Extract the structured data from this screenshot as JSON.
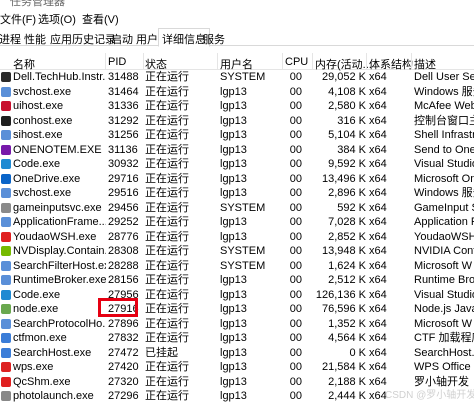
{
  "app": {
    "title": "任务管理器"
  },
  "menu": [
    "文件(F)",
    "选项(O)",
    "查看(V)"
  ],
  "tabs": [
    "进程",
    "性能",
    "应用历史记录",
    "启动",
    "用户",
    "详细信息",
    "服务"
  ],
  "active_tab": "详细信息",
  "columns": [
    "名称",
    "PID",
    "状态",
    "用户名",
    "CPU",
    "内存(活动...",
    "体系结构",
    "描述"
  ],
  "rows": [
    {
      "name": "Dell.TechHub.Instr...",
      "pid": "31488",
      "status": "正在运行",
      "user": "SYSTEM",
      "cpu": "00",
      "mem": "29,052 K",
      "arch": "x64",
      "desc": "Dell User Sess",
      "icon_color": "#2a2a2a"
    },
    {
      "name": "svchost.exe",
      "pid": "31464",
      "status": "正在运行",
      "user": "lgp13",
      "cpu": "00",
      "mem": "4,108 K",
      "arch": "x64",
      "desc": "Windows 服务",
      "icon_color": "#5a8fd8"
    },
    {
      "name": "uihost.exe",
      "pid": "31336",
      "status": "正在运行",
      "user": "lgp13",
      "cpu": "00",
      "mem": "2,580 K",
      "arch": "x64",
      "desc": "McAfee WebA",
      "icon_color": "#c8102e"
    },
    {
      "name": "conhost.exe",
      "pid": "31292",
      "status": "正在运行",
      "user": "lgp13",
      "cpu": "00",
      "mem": "316 K",
      "arch": "x64",
      "desc": "控制台窗口主",
      "icon_color": "#1e1e1e"
    },
    {
      "name": "sihost.exe",
      "pid": "31256",
      "status": "正在运行",
      "user": "lgp13",
      "cpu": "00",
      "mem": "5,104 K",
      "arch": "x64",
      "desc": "Shell Infrastru",
      "icon_color": "#5a8fd8"
    },
    {
      "name": "ONENOTEM.EXE",
      "pid": "31136",
      "status": "正在运行",
      "user": "lgp13",
      "cpu": "00",
      "mem": "384 K",
      "arch": "x64",
      "desc": "Send to One",
      "icon_color": "#7719aa"
    },
    {
      "name": "Code.exe",
      "pid": "30932",
      "status": "正在运行",
      "user": "lgp13",
      "cpu": "00",
      "mem": "9,592 K",
      "arch": "x64",
      "desc": "Visual Studio",
      "icon_color": "#1f8ad2"
    },
    {
      "name": "OneDrive.exe",
      "pid": "29716",
      "status": "正在运行",
      "user": "lgp13",
      "cpu": "00",
      "mem": "13,496 K",
      "arch": "x64",
      "desc": "Microsoft On",
      "icon_color": "#0a64c8"
    },
    {
      "name": "svchost.exe",
      "pid": "29516",
      "status": "正在运行",
      "user": "lgp13",
      "cpu": "00",
      "mem": "2,896 K",
      "arch": "x64",
      "desc": "Windows 服务",
      "icon_color": "#5a8fd8"
    },
    {
      "name": "gameinputsvc.exe",
      "pid": "29456",
      "status": "正在运行",
      "user": "SYSTEM",
      "cpu": "00",
      "mem": "592 K",
      "arch": "x64",
      "desc": "GameInput S",
      "icon_color": "#8a8a8a"
    },
    {
      "name": "ApplicationFrame...",
      "pid": "29252",
      "status": "正在运行",
      "user": "lgp13",
      "cpu": "00",
      "mem": "7,028 K",
      "arch": "x64",
      "desc": "Application F",
      "icon_color": "#5a8fd8"
    },
    {
      "name": "YoudaoWSH.exe",
      "pid": "28776",
      "status": "正在运行",
      "user": "lgp13",
      "cpu": "00",
      "mem": "2,852 K",
      "arch": "x64",
      "desc": "YoudaoWSH",
      "icon_color": "#e02020"
    },
    {
      "name": "NVDisplay.Contain...",
      "pid": "28308",
      "status": "正在运行",
      "user": "SYSTEM",
      "cpu": "00",
      "mem": "13,948 K",
      "arch": "x64",
      "desc": "NVIDIA Conta",
      "icon_color": "#76b900"
    },
    {
      "name": "SearchFilterHost.exe",
      "pid": "28288",
      "status": "正在运行",
      "user": "SYSTEM",
      "cpu": "00",
      "mem": "1,624 K",
      "arch": "x64",
      "desc": "Microsoft W",
      "icon_color": "#5a8fd8"
    },
    {
      "name": "RuntimeBroker.exe",
      "pid": "28156",
      "status": "正在运行",
      "user": "lgp13",
      "cpu": "00",
      "mem": "2,512 K",
      "arch": "x64",
      "desc": "Runtime Brok",
      "icon_color": "#5a8fd8"
    },
    {
      "name": "Code.exe",
      "pid": "27956",
      "status": "正在运行",
      "user": "lgp13",
      "cpu": "00",
      "mem": "126,136 K",
      "arch": "x64",
      "desc": "Visual Studio",
      "icon_color": "#1f8ad2"
    },
    {
      "name": "node.exe",
      "pid": "27916",
      "status": "正在运行",
      "user": "lgp13",
      "cpu": "00",
      "mem": "76,596 K",
      "arch": "x64",
      "desc": "Node.js Java",
      "icon_color": "#6aa84f"
    },
    {
      "name": "SearchProtocolHo...",
      "pid": "27896",
      "status": "正在运行",
      "user": "lgp13",
      "cpu": "00",
      "mem": "1,352 K",
      "arch": "x64",
      "desc": "Microsoft W",
      "icon_color": "#5a8fd8"
    },
    {
      "name": "ctfmon.exe",
      "pid": "27832",
      "status": "正在运行",
      "user": "lgp13",
      "cpu": "00",
      "mem": "4,564 K",
      "arch": "x64",
      "desc": "CTF 加载程序",
      "icon_color": "#3b7dd8"
    },
    {
      "name": "SearchHost.exe",
      "pid": "27472",
      "status": "已挂起",
      "user": "lgp13",
      "cpu": "00",
      "mem": "0 K",
      "arch": "x64",
      "desc": "SearchHost.e",
      "icon_color": "#3b7dd8"
    },
    {
      "name": "wps.exe",
      "pid": "27420",
      "status": "正在运行",
      "user": "lgp13",
      "cpu": "00",
      "mem": "21,584 K",
      "arch": "x64",
      "desc": "WPS Office",
      "icon_color": "#d22"
    },
    {
      "name": "QcShm.exe",
      "pid": "27320",
      "status": "正在运行",
      "user": "lgp13",
      "cpu": "00",
      "mem": "2,188 K",
      "arch": "x64",
      "desc": "罗小轴开发",
      "icon_color": "#e02020"
    },
    {
      "name": "photolaunch.exe",
      "pid": "27296",
      "status": "正在运行",
      "user": "lgp13",
      "cpu": "00",
      "mem": "2,444 K",
      "arch": "x64",
      "desc": "",
      "icon_color": "#888888"
    }
  ],
  "watermark": "CSDN @罗小轴开发"
}
